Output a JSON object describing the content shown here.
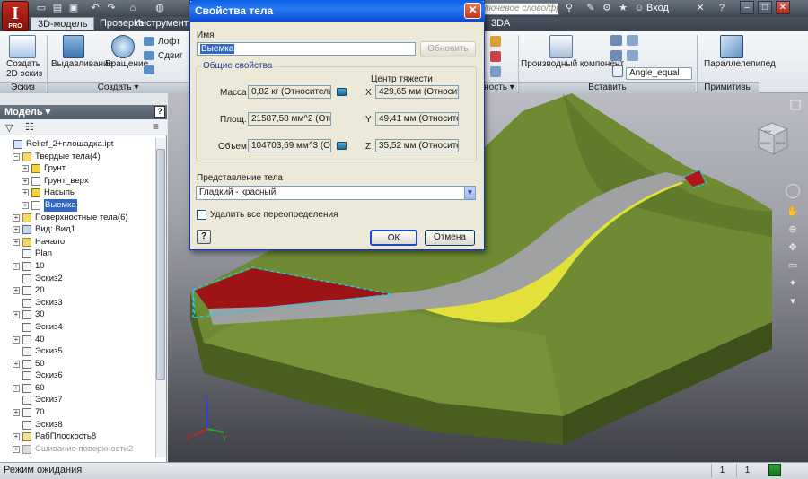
{
  "app": {
    "logo_letter": "I",
    "logo_sub": "PRO",
    "search_placeholder": "лючевое слово/фразу",
    "login": "Вход",
    "min": "–",
    "max": "□",
    "close": "✕"
  },
  "tabs": [
    {
      "label": "3D-модель",
      "active": true
    },
    {
      "label": "Проверка",
      "active": false
    },
    {
      "label": "Инструменты",
      "active": false
    },
    {
      "label": "3DA",
      "active": false
    }
  ],
  "ribbon": {
    "sketch2d": [
      "Создать",
      "2D эскиз"
    ],
    "extrude": "Выдавливание",
    "revolve": "Вращение",
    "loft": "Лофт",
    "sweep": "Сдвиг",
    "derived": "Производный компонент",
    "angle_equal": "Angle_equal",
    "parallelepiped": "Параллелепипед",
    "panels": {
      "sketch": "Эскиз",
      "create": "Создать ▾",
      "place": "Вставить",
      "primitives": "Примитивы",
      "partial": "ность ▾"
    }
  },
  "browser": {
    "title": "Модель ▾",
    "help": "?",
    "tree": [
      {
        "label": "Relief_2+площадка.ipt",
        "level": 0,
        "exp": "",
        "icon": "part"
      },
      {
        "label": "Твердые тела(4)",
        "level": 1,
        "exp": "−",
        "icon": "folder"
      },
      {
        "label": "Грунт",
        "level": 2,
        "exp": "+",
        "icon": "body-yellow"
      },
      {
        "label": "Грунт_верх",
        "level": 2,
        "exp": "+",
        "icon": "body-white"
      },
      {
        "label": "Насыпь",
        "level": 2,
        "exp": "+",
        "icon": "body-yellow"
      },
      {
        "label": "Выемка",
        "level": 2,
        "exp": "+",
        "icon": "body-white",
        "selected": true
      },
      {
        "label": "Поверхностные тела(6)",
        "level": 1,
        "exp": "+",
        "icon": "folder"
      },
      {
        "label": "Вид: Вид1",
        "level": 1,
        "exp": "+",
        "icon": "view"
      },
      {
        "label": "Начало",
        "level": 1,
        "exp": "+",
        "icon": "folder"
      },
      {
        "label": "Plan",
        "level": 1,
        "exp": "",
        "icon": "sketch"
      },
      {
        "label": "10",
        "level": 1,
        "exp": "+",
        "icon": "sketch"
      },
      {
        "label": "Эскиз2",
        "level": 1,
        "exp": "",
        "icon": "sketch"
      },
      {
        "label": "20",
        "level": 1,
        "exp": "+",
        "icon": "sketch"
      },
      {
        "label": "Эскиз3",
        "level": 1,
        "exp": "",
        "icon": "sketch"
      },
      {
        "label": "30",
        "level": 1,
        "exp": "+",
        "icon": "sketch"
      },
      {
        "label": "Эскиз4",
        "level": 1,
        "exp": "",
        "icon": "sketch"
      },
      {
        "label": "40",
        "level": 1,
        "exp": "+",
        "icon": "sketch"
      },
      {
        "label": "Эскиз5",
        "level": 1,
        "exp": "",
        "icon": "sketch"
      },
      {
        "label": "50",
        "level": 1,
        "exp": "+",
        "icon": "sketch"
      },
      {
        "label": "Эскиз6",
        "level": 1,
        "exp": "",
        "icon": "sketch"
      },
      {
        "label": "60",
        "level": 1,
        "exp": "+",
        "icon": "sketch"
      },
      {
        "label": "Эскиз7",
        "level": 1,
        "exp": "",
        "icon": "sketch"
      },
      {
        "label": "70",
        "level": 1,
        "exp": "+",
        "icon": "sketch"
      },
      {
        "label": "Эскиз8",
        "level": 1,
        "exp": "",
        "icon": "sketch"
      },
      {
        "label": "РабПлоскость8",
        "level": 1,
        "exp": "+",
        "icon": "plane"
      },
      {
        "label": "Сшивание поверхности2",
        "level": 1,
        "exp": "+",
        "icon": "stitch",
        "dim": true
      }
    ]
  },
  "dialog": {
    "title": "Свойства тела",
    "name_label": "Имя",
    "name_value": "Выемка",
    "update_btn": "Обновить",
    "group_title": "Общие свойства",
    "cog_title": "Центр тяжести",
    "mass_label": "Масса",
    "mass_value": "0,82 кг (Относителы",
    "area_label": "Площ.",
    "area_value": "21587,58 мм^2 (Отн",
    "volume_label": "Объем",
    "volume_value": "104703,69 мм^3 (От",
    "x_label": "X",
    "x_value": "429,65 мм (Относитель",
    "y_label": "Y",
    "y_value": "49,41 мм (Относитель",
    "z_label": "Z",
    "z_value": "35,52 мм (Относитель",
    "repr_label": "Представление тела",
    "repr_value": "Гладкий - красный",
    "delete_overrides": "Удалить все переопределения",
    "help": "?",
    "ok": "ОК",
    "cancel": "Отмена"
  },
  "viewcube": {
    "top": "TOP",
    "front": "FRONT",
    "right": "RIGHT"
  },
  "axes": {
    "x": "X",
    "y": "Y",
    "z": "Z"
  },
  "status": {
    "text": "Режим ожидания",
    "cell1": "1",
    "cell2": "1"
  }
}
